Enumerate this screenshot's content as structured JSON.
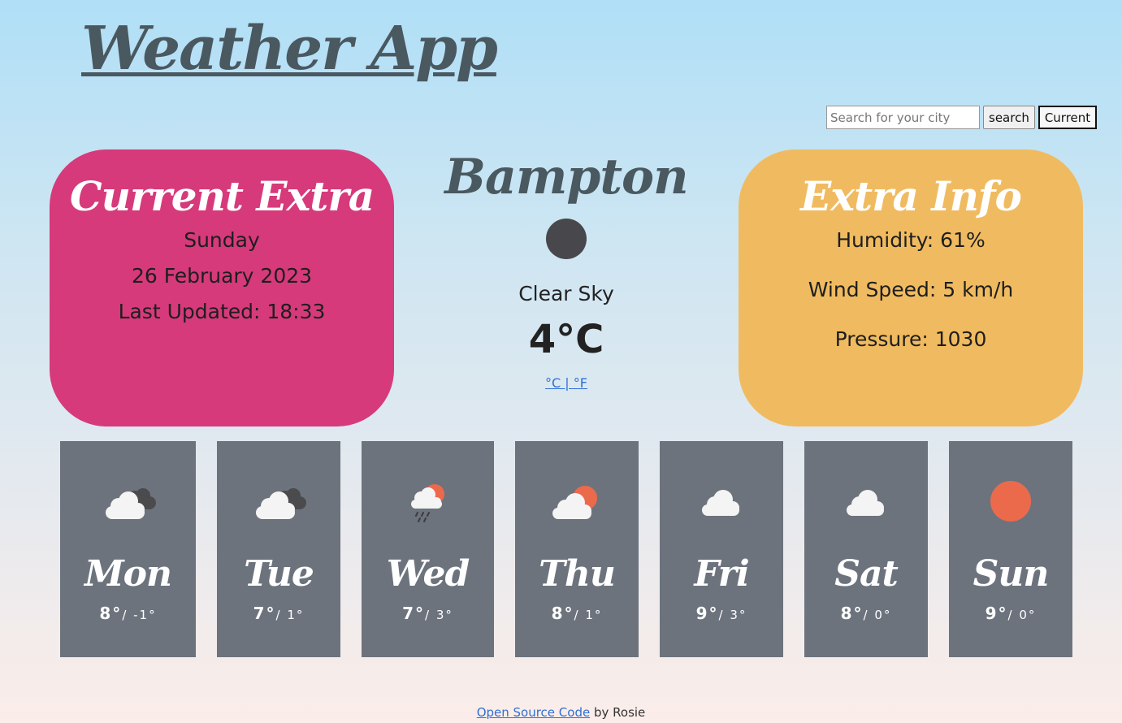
{
  "header": {
    "title": "Weather App"
  },
  "search": {
    "placeholder": "Search for your city",
    "value": "",
    "search_label": "search",
    "current_label": "Current"
  },
  "current_extra": {
    "title": "Current Extra",
    "day": "Sunday",
    "date": "26 February 2023",
    "last_updated": "Last Updated: 18:33"
  },
  "main": {
    "city": "Bampton",
    "icon": "moon-icon",
    "description": "Clear Sky",
    "temperature": "4°C",
    "unit_toggle": "°C | °F"
  },
  "extra_info": {
    "title": "Extra Info",
    "humidity": "Humidity: 61%",
    "wind": "Wind Speed: 5 km/h",
    "pressure": "Pressure: 1030"
  },
  "forecast": [
    {
      "day": "Mon",
      "max": "8°",
      "min": "/ -1°",
      "icon": "cloudy-icon"
    },
    {
      "day": "Tue",
      "max": "7°",
      "min": "/ 1°",
      "icon": "cloudy-icon"
    },
    {
      "day": "Wed",
      "max": "7°",
      "min": "/ 3°",
      "icon": "rain-sun-icon"
    },
    {
      "day": "Thu",
      "max": "8°",
      "min": "/ 1°",
      "icon": "partly-cloudy-icon"
    },
    {
      "day": "Fri",
      "max": "9°",
      "min": "/ 3°",
      "icon": "cloud-icon"
    },
    {
      "day": "Sat",
      "max": "8°",
      "min": "/ 0°",
      "icon": "cloud-icon"
    },
    {
      "day": "Sun",
      "max": "9°",
      "min": "/ 0°",
      "icon": "sun-icon"
    }
  ],
  "footer": {
    "link_text": "Open Source Code",
    "suffix": " by Rosie"
  },
  "colors": {
    "current_card": "#d63a7b",
    "extra_card": "#f0bb60",
    "forecast_card": "#6c737d",
    "sun": "#ec6a4c"
  }
}
